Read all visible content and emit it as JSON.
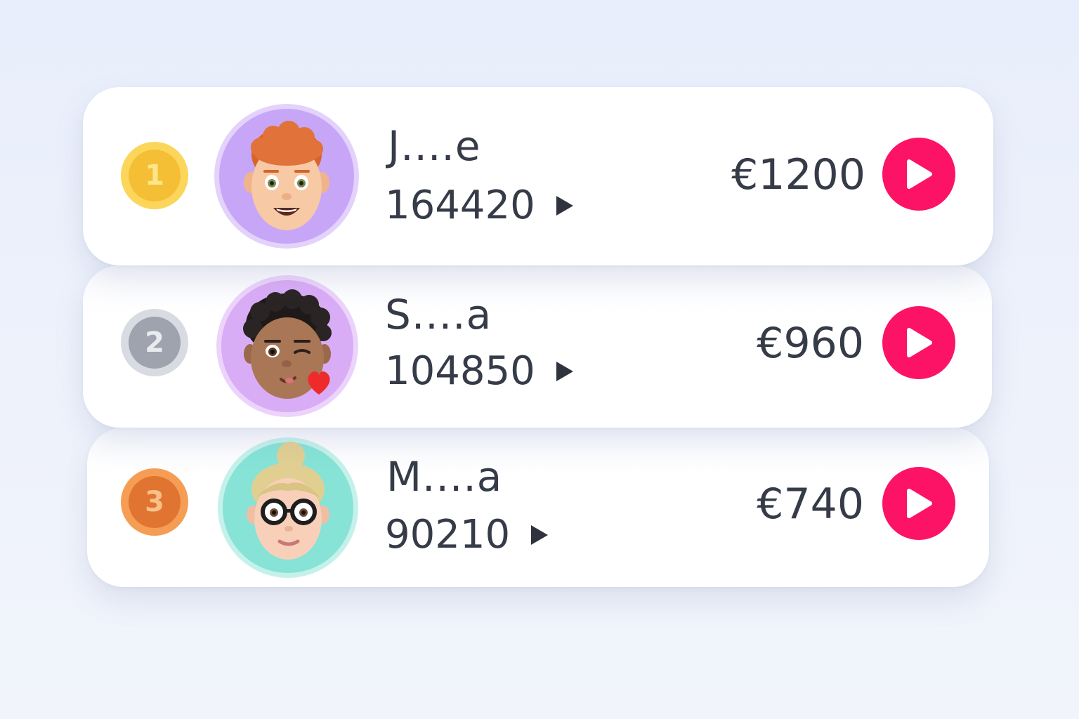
{
  "leaderboard": {
    "entries": [
      {
        "rank": "1",
        "medal": "gold-medal-icon",
        "avatar": "memoji-red-curly-hair-avatar",
        "name": "J....e",
        "score": "164420",
        "prize": "€1200",
        "avatar_bg": "#c7a6f7"
      },
      {
        "rank": "2",
        "medal": "silver-medal-icon",
        "avatar": "memoji-winking-heart-avatar",
        "name": "S....a",
        "score": "104850",
        "prize": "€960",
        "avatar_bg": "#d9acf6"
      },
      {
        "rank": "3",
        "medal": "bronze-medal-icon",
        "avatar": "memoji-blonde-glasses-avatar",
        "name": "M....a",
        "score": "90210",
        "prize": "€740",
        "avatar_bg": "#86e3d6"
      }
    ]
  },
  "colors": {
    "accent": "#fc1366",
    "text": "#363b48",
    "gold": "#f4bf34",
    "silver": "#9ea3ae",
    "bronze": "#e07531",
    "background": "#eaeffb"
  }
}
